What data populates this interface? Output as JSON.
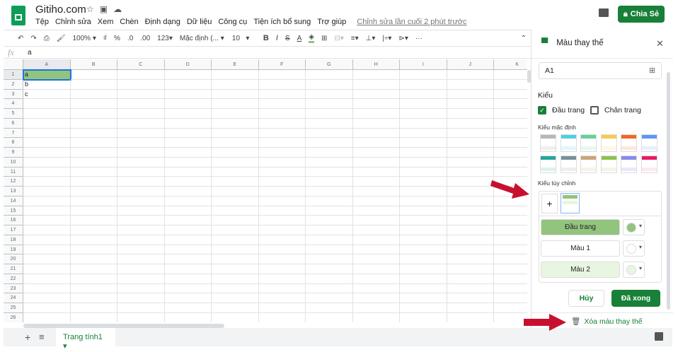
{
  "doc": {
    "title": "Gitiho.com",
    "last_edit": "Chỉnh sửa lần cuối 2 phút trước",
    "share_label": "Chia Sẻ"
  },
  "menu": [
    "Tệp",
    "Chỉnh sửa",
    "Xem",
    "Chèn",
    "Định dạng",
    "Dữ liệu",
    "Công cụ",
    "Tiện ích bổ sung",
    "Trợ giúp"
  ],
  "toolbar": {
    "zoom": "100%",
    "currency": "₫",
    "percent": "%",
    "dec_less": ".0",
    "dec_more": ".00",
    "format": "123",
    "font": "Mặc định (...",
    "size": "10",
    "bold": "B",
    "italic": "I",
    "strike": "S",
    "text_color": "A",
    "more": "···"
  },
  "formula": {
    "fx": "fx",
    "value": "a"
  },
  "columns": [
    "A",
    "B",
    "C",
    "D",
    "E",
    "F",
    "G",
    "H",
    "I",
    "J",
    "K"
  ],
  "rows": [
    "1",
    "2",
    "3",
    "4",
    "5",
    "6",
    "7",
    "8",
    "9",
    "10",
    "11",
    "12",
    "13",
    "14",
    "15",
    "16",
    "17",
    "18",
    "19",
    "20",
    "21",
    "22",
    "23",
    "24",
    "25",
    "26"
  ],
  "cells": {
    "A1": "a",
    "A2": "b",
    "A3": "c"
  },
  "sheet_tab": "Trang tính1",
  "sidebar": {
    "title": "Màu thay thế",
    "range": "A1",
    "style_heading": "Kiểu",
    "header_check": "Đầu trang",
    "footer_check": "Chân trang",
    "default_styles": "Kiểu mặc định",
    "custom_styles": "Kiểu tùy chỉnh",
    "header_row": "Đầu trang",
    "color1": "Màu 1",
    "color2": "Màu 2",
    "cancel": "Hủy",
    "done": "Đã xong",
    "remove": "Xóa màu thay thế",
    "palettes": [
      [
        "#b7b7b7",
        "#efefef"
      ],
      [
        "#4dd0e1",
        "#e0f7fa"
      ],
      [
        "#63d297",
        "#e7f9ef"
      ],
      [
        "#f7cb4d",
        "#fef8e3"
      ],
      [
        "#f46524",
        "#ffe6dd"
      ],
      [
        "#5b95f9",
        "#e8f0fe"
      ],
      [
        "#26a69a",
        "#ddf2f0"
      ],
      [
        "#78909c",
        "#ebeff1"
      ],
      [
        "#cca677",
        "#f8f2eb"
      ],
      [
        "#8bc34a",
        "#eef7e3"
      ],
      [
        "#8989eb",
        "#e8e7fc"
      ],
      [
        "#e91d63",
        "#fdeaf1"
      ]
    ],
    "header_color": "#93c47d",
    "color1_value": "#ffffff",
    "color2_value": "#e8f5e0"
  },
  "accent": "#188038"
}
